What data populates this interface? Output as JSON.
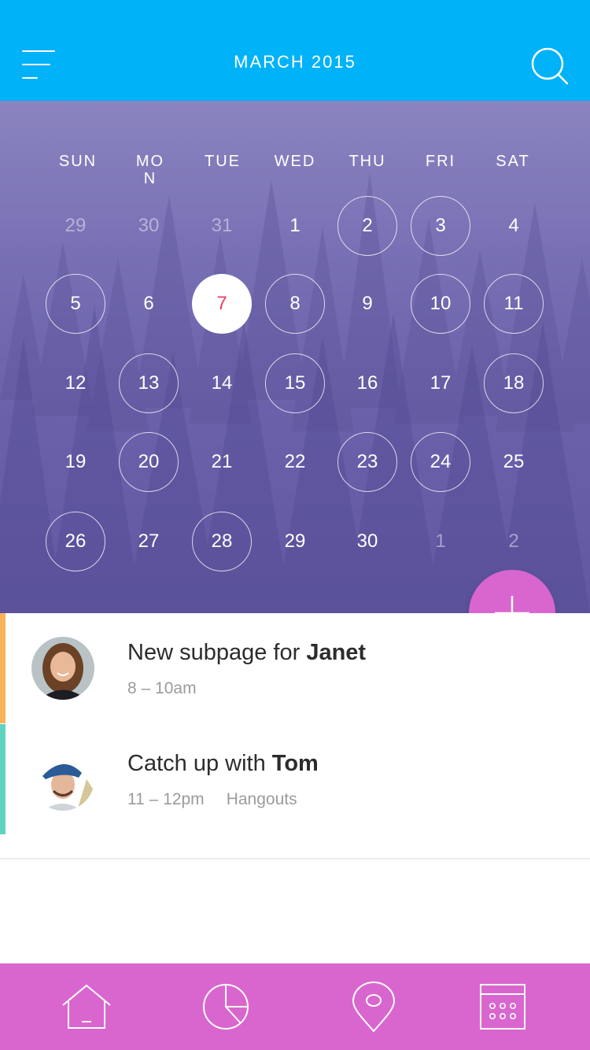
{
  "header": {
    "title": "MARCH 2015",
    "menu_icon": "menu-icon",
    "search_icon": "search-icon",
    "bg_color": "#00b2f8"
  },
  "calendar": {
    "weekdays": [
      "SUN",
      "MON",
      "TUE",
      "WED",
      "THU",
      "FRI",
      "SAT"
    ],
    "weeks": [
      [
        {
          "d": "29",
          "muted": true
        },
        {
          "d": "30",
          "muted": true
        },
        {
          "d": "31",
          "muted": true
        },
        {
          "d": "1"
        },
        {
          "d": "2",
          "ring": true
        },
        {
          "d": "3",
          "ring": true
        },
        {
          "d": "4"
        }
      ],
      [
        {
          "d": "5",
          "ring": true
        },
        {
          "d": "6"
        },
        {
          "d": "7",
          "today": true
        },
        {
          "d": "8",
          "ring": true
        },
        {
          "d": "9"
        },
        {
          "d": "10",
          "ring": true
        },
        {
          "d": "11",
          "ring": true
        }
      ],
      [
        {
          "d": "12"
        },
        {
          "d": "13",
          "ring": true
        },
        {
          "d": "14"
        },
        {
          "d": "15",
          "ring": true
        },
        {
          "d": "16"
        },
        {
          "d": "17"
        },
        {
          "d": "18",
          "ring": true
        }
      ],
      [
        {
          "d": "19"
        },
        {
          "d": "20",
          "ring": true
        },
        {
          "d": "21"
        },
        {
          "d": "22"
        },
        {
          "d": "23",
          "ring": true
        },
        {
          "d": "24",
          "ring": true
        },
        {
          "d": "25"
        }
      ],
      [
        {
          "d": "26",
          "ring": true
        },
        {
          "d": "27"
        },
        {
          "d": "28",
          "ring": true
        },
        {
          "d": "29"
        },
        {
          "d": "30"
        },
        {
          "d": "1",
          "muted": true
        },
        {
          "d": "2",
          "muted": true
        }
      ]
    ],
    "today_color": "#ee3d63"
  },
  "fab": {
    "icon": "plus-icon",
    "color": "#d966cf"
  },
  "events": [
    {
      "title_prefix": "New subpage for ",
      "title_name": "Janet",
      "time": "8 – 10am",
      "location": "",
      "accent": "#f8b25a",
      "avatar": "avatar-janet"
    },
    {
      "title_prefix": "Catch up with ",
      "title_name": "Tom",
      "time": "11 – 12pm",
      "location": "Hangouts",
      "accent": "#5ed3c1",
      "avatar": "avatar-tom"
    }
  ],
  "bottom_nav": {
    "color": "#d966cf",
    "items": [
      "home-icon",
      "pie-chart-icon",
      "location-pin-icon",
      "calendar-icon"
    ]
  }
}
